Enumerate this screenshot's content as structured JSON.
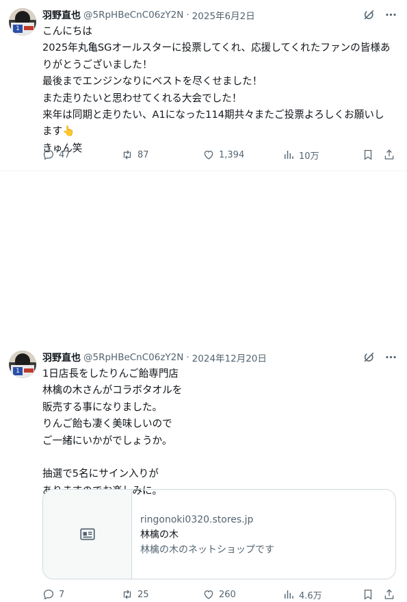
{
  "tweets": [
    {
      "author_name": "羽野直也",
      "handle": "@5RpHBeCnC06zY2N",
      "date": "2025年6月2日",
      "lines": [
        "こんにちは",
        "2025年丸亀SGオールスターに投票してくれ、応援してくれたファンの皆様あ",
        "りがとうございました！",
        "最後までエンジンなりにベストを尽くせました！",
        "また走りたいと思わせてくれる大会でした！",
        "来年は同期と走りたい、A1になった114期共々またご投票よろしくお願いし",
        "ます👆",
        "きゅん笑"
      ],
      "replies": "47",
      "retweets": "87",
      "likes": "1,394",
      "views": "10万"
    },
    {
      "author_name": "羽野直也",
      "handle": "@5RpHBeCnC06zY2N",
      "date": "2024年12月20日",
      "lines": [
        "1日店長をしたりんご飴専門店",
        "林檎の木さんがコラボタオルを",
        "販売する事になりました。",
        "りんご飴も凄く美味しいので",
        "ご一緒にいかがでしょうか。",
        "",
        "抽選で5名にサイン入りが",
        "ありますのでお楽しみに。"
      ],
      "card": {
        "domain": "ringonoki0320.stores.jp",
        "title": "林檎の木",
        "description": "林檎の木のネットショップです"
      },
      "replies": "7",
      "retweets": "25",
      "likes": "260",
      "views": "4.6万"
    }
  ],
  "icons": {
    "grok": "grok-icon",
    "more": "more-icon",
    "reply": "reply-icon",
    "retweet": "retweet-icon",
    "like": "like-icon",
    "views": "views-icon",
    "bookmark": "bookmark-icon",
    "share": "share-icon"
  },
  "colors": {
    "text": "#0f1419",
    "secondary": "#536471",
    "border": "#cfd9de"
  }
}
